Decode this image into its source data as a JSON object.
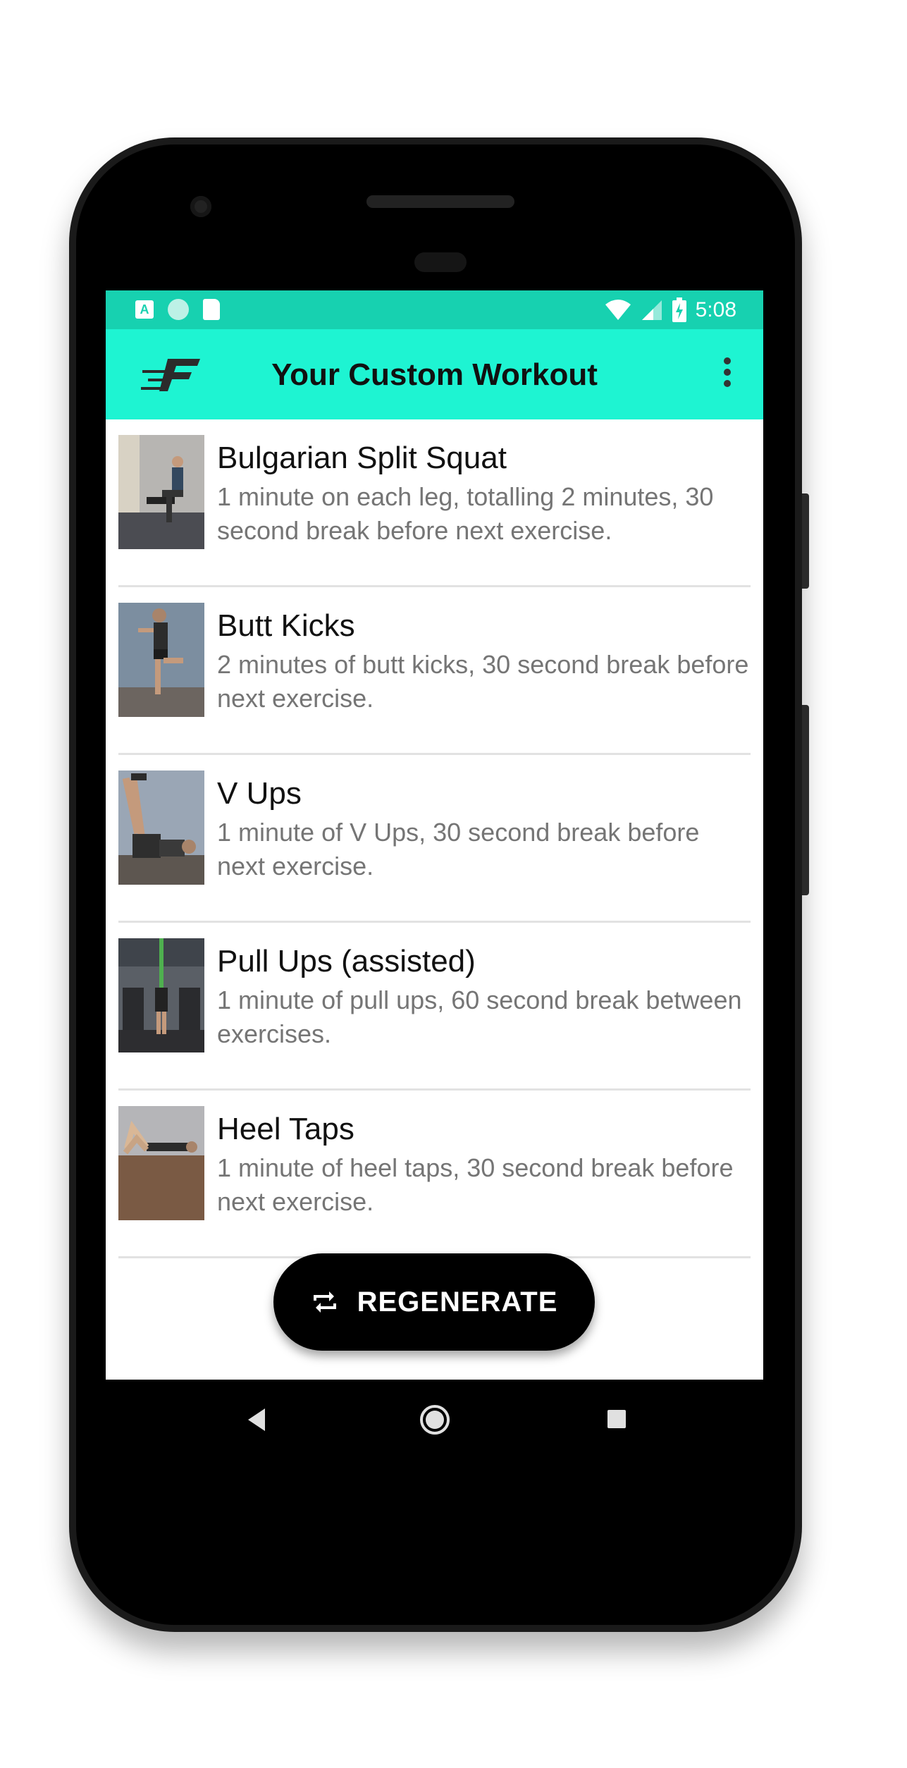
{
  "status_bar": {
    "time": "5:08",
    "notification_icons": [
      "app-a-icon",
      "circle-icon",
      "sd-card-icon"
    ],
    "system_icons": [
      "wifi-icon",
      "signal-icon",
      "battery-charging-icon"
    ]
  },
  "app_bar": {
    "logo_icon": "app-logo-f-icon",
    "title": "Your Custom Workout",
    "menu_icon": "more-vertical-icon"
  },
  "exercises": [
    {
      "title": "Bulgarian Split Squat",
      "description": "1 minute on each leg, totalling 2 minutes, 30 second break before next exercise."
    },
    {
      "title": "Butt Kicks",
      "description": "2 minutes of butt kicks, 30 second break before next exercise."
    },
    {
      "title": "V Ups",
      "description": "1 minute of V Ups, 30 second break before next exercise."
    },
    {
      "title": "Pull Ups (assisted)",
      "description": "1 minute of pull ups, 60 second break between exercises."
    },
    {
      "title": "Heel Taps",
      "description": "1 minute of heel taps, 30 second break before next exercise."
    }
  ],
  "regenerate_button": {
    "label": "REGENERATE",
    "icon": "repeat-icon"
  },
  "nav_bar": {
    "items": [
      "back-icon",
      "home-icon",
      "recents-icon"
    ]
  },
  "colors": {
    "status_bar": "#17d1b0",
    "app_bar": "#1ef4d2",
    "button": "#000000"
  }
}
